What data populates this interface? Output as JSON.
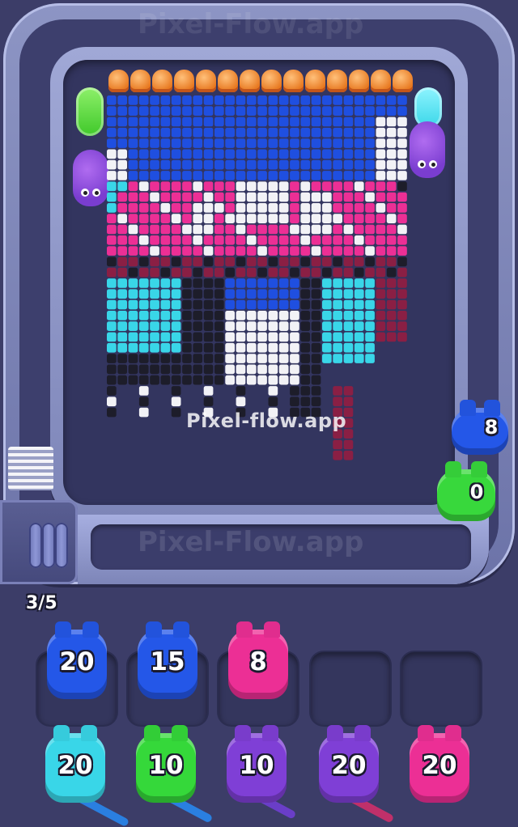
{
  "watermark": "Pixel-flow.app",
  "ghost_watermark": "Pixel-Flow.app",
  "progress_label": "3/5",
  "colors": {
    "background": "#3c3d68",
    "blue": "#1f4fe0",
    "cyan": "#39d6e8",
    "green": "#35d83a",
    "purple": "#7f3fd6",
    "pink": "#ec2f95",
    "orange": "#f08a2c"
  },
  "track_shooters": [
    {
      "value": "8",
      "color": "blue"
    },
    {
      "value": "0",
      "color": "green"
    }
  ],
  "queue_top": [
    {
      "value": "20",
      "color": "blue"
    },
    {
      "value": "15",
      "color": "blue"
    },
    {
      "value": "8",
      "color": "pink"
    },
    {
      "value": "",
      "color": "empty"
    },
    {
      "value": "",
      "color": "empty"
    }
  ],
  "queue_bottom": [
    {
      "value": "20",
      "color": "cyan"
    },
    {
      "value": "10",
      "color": "green"
    },
    {
      "value": "10",
      "color": "purple"
    },
    {
      "value": "20",
      "color": "purple"
    },
    {
      "value": "20",
      "color": "pink"
    }
  ],
  "icons": [
    "orange-cap-icon",
    "purple-creature-icon",
    "piggy-bank-icon"
  ]
}
